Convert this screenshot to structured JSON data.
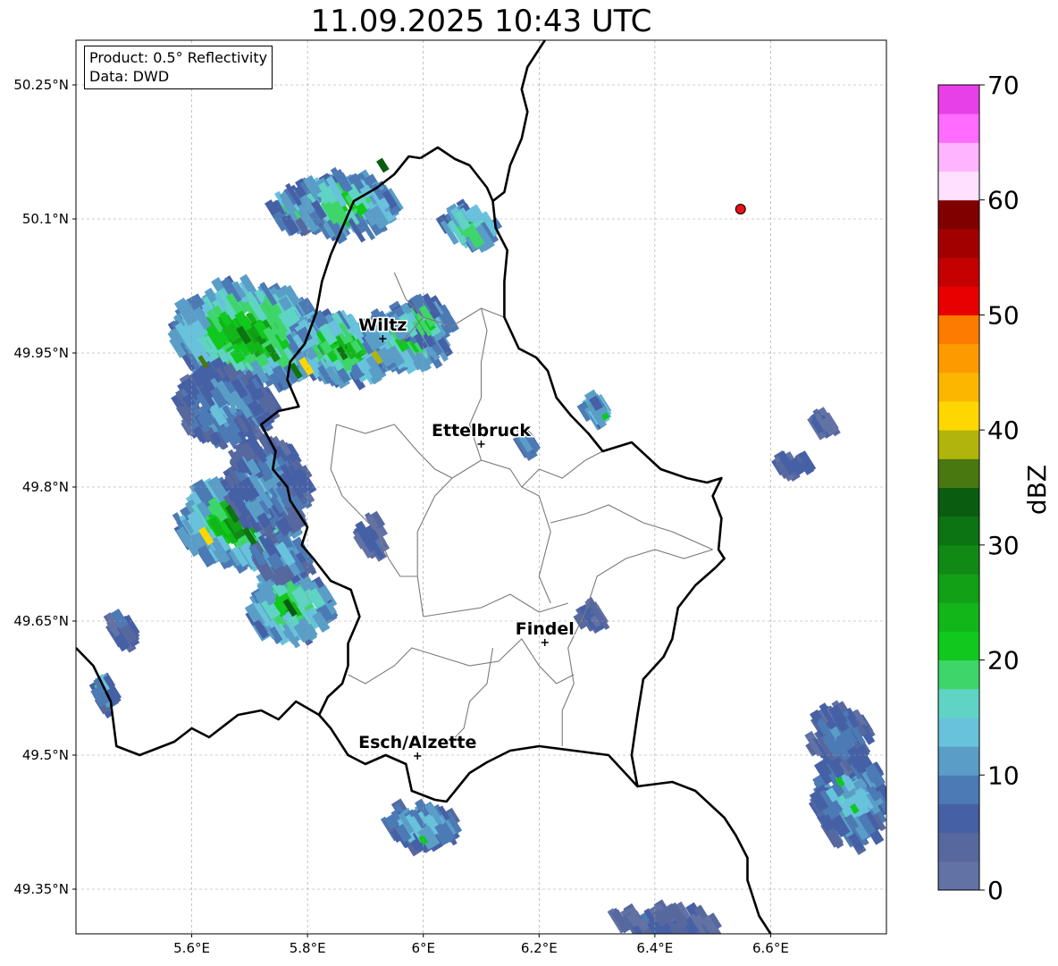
{
  "title": "11.09.2025 10:43 UTC",
  "info": {
    "product": "Product: 0.5° Reflectivity",
    "data": "Data: DWD"
  },
  "map": {
    "lon_range": [
      5.4,
      6.8
    ],
    "lat_range": [
      49.3,
      50.3
    ],
    "lon_ticks": [
      {
        "value": 5.6,
        "label": "5.6°E"
      },
      {
        "value": 5.8,
        "label": "5.8°E"
      },
      {
        "value": 6.0,
        "label": "6°E"
      },
      {
        "value": 6.2,
        "label": "6.2°E"
      },
      {
        "value": 6.4,
        "label": "6.4°E"
      },
      {
        "value": 6.6,
        "label": "6.6°E"
      }
    ],
    "lat_ticks": [
      {
        "value": 49.35,
        "label": "49.35°N"
      },
      {
        "value": 49.5,
        "label": "49.5°N"
      },
      {
        "value": 49.65,
        "label": "49.65°N"
      },
      {
        "value": 49.8,
        "label": "49.8°N"
      },
      {
        "value": 49.95,
        "label": "49.95°N"
      },
      {
        "value": 50.1,
        "label": "50.1°N"
      },
      {
        "value": 50.25,
        "label": "50.25°N"
      }
    ],
    "cities": [
      {
        "name": "Wiltz",
        "lon": 5.93,
        "lat": 49.966
      },
      {
        "name": "Ettelbruck",
        "lon": 6.1,
        "lat": 49.848
      },
      {
        "name": "Findel",
        "lon": 6.21,
        "lat": 49.626
      },
      {
        "name": "Esch/Alzette",
        "lon": 5.99,
        "lat": 49.499
      }
    ],
    "radar_site": {
      "lon": 6.548,
      "lat": 50.111,
      "color": "#e8101a"
    },
    "echo_cells": [
      {
        "lon": 5.7,
        "lat": 49.97,
        "rlon": 0.13,
        "rlat": 0.055,
        "dbz": 26
      },
      {
        "lon": 5.86,
        "lat": 49.955,
        "rlon": 0.09,
        "rlat": 0.035,
        "dbz": 24
      },
      {
        "lon": 5.97,
        "lat": 49.965,
        "rlon": 0.07,
        "rlat": 0.03,
        "dbz": 22
      },
      {
        "lon": 6.0,
        "lat": 49.985,
        "rlon": 0.05,
        "rlat": 0.02,
        "dbz": 20
      },
      {
        "lon": 5.66,
        "lat": 49.89,
        "rlon": 0.08,
        "rlat": 0.04,
        "dbz": 12
      },
      {
        "lon": 5.86,
        "lat": 50.115,
        "rlon": 0.09,
        "rlat": 0.03,
        "dbz": 22
      },
      {
        "lon": 5.78,
        "lat": 50.11,
        "rlon": 0.04,
        "rlat": 0.02,
        "dbz": 18
      },
      {
        "lon": 6.08,
        "lat": 50.09,
        "rlon": 0.045,
        "rlat": 0.02,
        "dbz": 22
      },
      {
        "lon": 5.68,
        "lat": 49.76,
        "rlon": 0.1,
        "rlat": 0.045,
        "dbz": 26
      },
      {
        "lon": 5.73,
        "lat": 49.8,
        "rlon": 0.07,
        "rlat": 0.05,
        "dbz": 12
      },
      {
        "lon": 5.77,
        "lat": 49.665,
        "rlon": 0.07,
        "rlat": 0.035,
        "dbz": 24
      },
      {
        "lon": 5.76,
        "lat": 49.72,
        "rlon": 0.05,
        "rlat": 0.02,
        "dbz": 14
      },
      {
        "lon": 6.0,
        "lat": 49.42,
        "rlon": 0.06,
        "rlat": 0.02,
        "dbz": 16
      },
      {
        "lon": 6.74,
        "lat": 49.45,
        "rlon": 0.06,
        "rlat": 0.05,
        "dbz": 16
      },
      {
        "lon": 6.72,
        "lat": 49.52,
        "rlon": 0.05,
        "rlat": 0.03,
        "dbz": 10
      },
      {
        "lon": 6.42,
        "lat": 49.31,
        "rlon": 0.09,
        "rlat": 0.015,
        "dbz": 6
      },
      {
        "lon": 5.48,
        "lat": 49.64,
        "rlon": 0.02,
        "rlat": 0.015,
        "dbz": 8
      },
      {
        "lon": 5.45,
        "lat": 49.57,
        "rlon": 0.015,
        "rlat": 0.015,
        "dbz": 16
      },
      {
        "lon": 6.3,
        "lat": 49.885,
        "rlon": 0.02,
        "rlat": 0.01,
        "dbz": 20
      },
      {
        "lon": 6.18,
        "lat": 49.85,
        "rlon": 0.01,
        "rlat": 0.008,
        "dbz": 14
      },
      {
        "lon": 6.29,
        "lat": 49.655,
        "rlon": 0.02,
        "rlat": 0.01,
        "dbz": 6
      },
      {
        "lon": 5.91,
        "lat": 49.745,
        "rlon": 0.02,
        "rlat": 0.02,
        "dbz": 8
      },
      {
        "lon": 6.64,
        "lat": 49.825,
        "rlon": 0.03,
        "rlat": 0.006,
        "dbz": 8
      },
      {
        "lon": 6.69,
        "lat": 49.87,
        "rlon": 0.015,
        "rlat": 0.006,
        "dbz": 6
      }
    ],
    "echo_strokes": [
      {
        "lon": 5.69,
        "lat": 49.97,
        "w": 0.012,
        "h": 0.02,
        "dbz": 30
      },
      {
        "lon": 5.74,
        "lat": 49.95,
        "w": 0.012,
        "h": 0.02,
        "dbz": 28
      },
      {
        "lon": 5.78,
        "lat": 49.93,
        "w": 0.01,
        "h": 0.018,
        "dbz": 32
      },
      {
        "lon": 5.86,
        "lat": 49.95,
        "w": 0.01,
        "h": 0.015,
        "dbz": 32
      },
      {
        "lon": 5.67,
        "lat": 49.77,
        "w": 0.01,
        "h": 0.02,
        "dbz": 32
      },
      {
        "lon": 5.7,
        "lat": 49.745,
        "w": 0.01,
        "h": 0.02,
        "dbz": 30
      },
      {
        "lon": 5.625,
        "lat": 49.745,
        "w": 0.012,
        "h": 0.02,
        "dbz": 40
      },
      {
        "lon": 5.798,
        "lat": 49.935,
        "w": 0.012,
        "h": 0.02,
        "dbz": 40
      },
      {
        "lon": 5.92,
        "lat": 49.945,
        "w": 0.01,
        "h": 0.015,
        "dbz": 38
      },
      {
        "lon": 5.77,
        "lat": 49.665,
        "w": 0.01,
        "h": 0.02,
        "dbz": 34
      },
      {
        "lon": 5.93,
        "lat": 50.16,
        "w": 0.012,
        "h": 0.015,
        "dbz": 34
      },
      {
        "lon": 5.62,
        "lat": 49.94,
        "w": 0.008,
        "h": 0.015,
        "dbz": 36
      },
      {
        "lon": 6.0,
        "lat": 49.405,
        "w": 0.01,
        "h": 0.01,
        "dbz": 22
      },
      {
        "lon": 6.745,
        "lat": 49.44,
        "w": 0.01,
        "h": 0.01,
        "dbz": 22
      },
      {
        "lon": 6.72,
        "lat": 49.47,
        "w": 0.01,
        "h": 0.01,
        "dbz": 22
      }
    ],
    "borders": {
      "country_outline": [
        [
          5.995,
          50.168
        ],
        [
          6.025,
          50.18
        ],
        [
          6.055,
          50.167
        ],
        [
          6.08,
          50.16
        ],
        [
          6.11,
          50.135
        ],
        [
          6.12,
          50.12
        ],
        [
          6.125,
          50.09
        ],
        [
          6.145,
          50.065
        ],
        [
          6.14,
          50.03
        ],
        [
          6.14,
          49.99
        ],
        [
          6.165,
          49.955
        ],
        [
          6.195,
          49.945
        ],
        [
          6.215,
          49.93
        ],
        [
          6.23,
          49.9
        ],
        [
          6.255,
          49.88
        ],
        [
          6.285,
          49.86
        ],
        [
          6.31,
          49.84
        ],
        [
          6.36,
          49.85
        ],
        [
          6.41,
          49.82
        ],
        [
          6.455,
          49.81
        ],
        [
          6.49,
          49.805
        ],
        [
          6.515,
          49.81
        ],
        [
          6.5,
          49.79
        ],
        [
          6.515,
          49.765
        ],
        [
          6.51,
          49.73
        ],
        [
          6.52,
          49.72
        ],
        [
          6.505,
          49.71
        ],
        [
          6.47,
          49.69
        ],
        [
          6.44,
          49.665
        ],
        [
          6.43,
          49.63
        ],
        [
          6.415,
          49.61
        ],
        [
          6.38,
          49.585
        ],
        [
          6.37,
          49.545
        ],
        [
          6.36,
          49.5
        ],
        [
          6.37,
          49.465
        ],
        [
          6.32,
          49.5
        ],
        [
          6.26,
          49.505
        ],
        [
          6.2,
          49.51
        ],
        [
          6.15,
          49.505
        ],
        [
          6.11,
          49.492
        ],
        [
          6.08,
          49.48
        ],
        [
          6.04,
          49.448
        ],
        [
          6.02,
          49.45
        ],
        [
          5.98,
          49.46
        ],
        [
          5.97,
          49.49
        ],
        [
          5.935,
          49.5
        ],
        [
          5.9,
          49.49
        ],
        [
          5.87,
          49.5
        ],
        [
          5.84,
          49.53
        ],
        [
          5.82,
          49.545
        ],
        [
          5.835,
          49.565
        ],
        [
          5.86,
          49.58
        ],
        [
          5.87,
          49.6
        ],
        [
          5.87,
          49.625
        ],
        [
          5.89,
          49.655
        ],
        [
          5.875,
          49.685
        ],
        [
          5.84,
          49.695
        ],
        [
          5.81,
          49.72
        ],
        [
          5.79,
          49.735
        ],
        [
          5.8,
          49.755
        ],
        [
          5.77,
          49.785
        ],
        [
          5.765,
          49.8
        ],
        [
          5.74,
          49.82
        ],
        [
          5.745,
          49.84
        ],
        [
          5.72,
          49.87
        ],
        [
          5.75,
          49.885
        ],
        [
          5.785,
          49.89
        ],
        [
          5.765,
          49.92
        ],
        [
          5.77,
          49.94
        ],
        [
          5.795,
          49.96
        ],
        [
          5.815,
          49.995
        ],
        [
          5.825,
          50.03
        ],
        [
          5.84,
          50.06
        ],
        [
          5.86,
          50.09
        ],
        [
          5.88,
          50.12
        ],
        [
          5.92,
          50.135
        ],
        [
          5.95,
          50.15
        ],
        [
          5.975,
          50.17
        ],
        [
          5.995,
          50.168
        ]
      ],
      "belgium_germany": [
        [
          6.12,
          50.12
        ],
        [
          6.14,
          50.13
        ],
        [
          6.15,
          50.16
        ],
        [
          6.17,
          50.19
        ],
        [
          6.18,
          50.22
        ],
        [
          6.17,
          50.245
        ],
        [
          6.18,
          50.27
        ],
        [
          6.2,
          50.29
        ],
        [
          6.21,
          50.3
        ]
      ],
      "france_west": [
        [
          5.4,
          49.62
        ],
        [
          5.43,
          49.6
        ],
        [
          5.46,
          49.56
        ],
        [
          5.47,
          49.51
        ],
        [
          5.51,
          49.5
        ],
        [
          5.57,
          49.515
        ],
        [
          5.6,
          49.53
        ],
        [
          5.63,
          49.52
        ],
        [
          5.68,
          49.545
        ],
        [
          5.72,
          49.55
        ],
        [
          5.75,
          49.54
        ],
        [
          5.78,
          49.56
        ],
        [
          5.82,
          49.545
        ]
      ],
      "germany_south": [
        [
          6.37,
          49.465
        ],
        [
          6.43,
          49.47
        ],
        [
          6.47,
          49.46
        ],
        [
          6.52,
          49.43
        ],
        [
          6.54,
          49.41
        ],
        [
          6.56,
          49.385
        ],
        [
          6.56,
          49.36
        ],
        [
          6.57,
          49.34
        ],
        [
          6.58,
          49.32
        ],
        [
          6.6,
          49.3
        ]
      ],
      "cantons": [
        [
          [
            5.87,
            49.59
          ],
          [
            5.9,
            49.58
          ],
          [
            5.95,
            49.6
          ],
          [
            5.98,
            49.62
          ],
          [
            6.03,
            49.61
          ],
          [
            6.08,
            49.6
          ],
          [
            6.13,
            49.605
          ],
          [
            6.17,
            49.63
          ],
          [
            6.2,
            49.6
          ],
          [
            6.23,
            49.58
          ],
          [
            6.26,
            49.59
          ]
        ],
        [
          [
            6.12,
            49.62
          ],
          [
            6.11,
            49.58
          ],
          [
            6.08,
            49.56
          ],
          [
            6.07,
            49.53
          ],
          [
            6.04,
            49.51
          ]
        ],
        [
          [
            6.24,
            49.51
          ],
          [
            6.24,
            49.55
          ],
          [
            6.26,
            49.58
          ],
          [
            6.25,
            49.62
          ],
          [
            6.28,
            49.66
          ],
          [
            6.3,
            49.7
          ],
          [
            6.35,
            49.72
          ],
          [
            6.4,
            49.73
          ],
          [
            6.45,
            49.72
          ],
          [
            6.5,
            49.73
          ]
        ],
        [
          [
            6.0,
            49.655
          ],
          [
            6.05,
            49.66
          ],
          [
            6.1,
            49.665
          ],
          [
            6.15,
            49.68
          ],
          [
            6.2,
            49.66
          ],
          [
            6.25,
            49.67
          ]
        ],
        [
          [
            6.0,
            49.655
          ],
          [
            5.99,
            49.7
          ],
          [
            5.99,
            49.75
          ],
          [
            6.02,
            49.79
          ],
          [
            6.05,
            49.81
          ],
          [
            6.1,
            49.83
          ],
          [
            6.15,
            49.82
          ],
          [
            6.17,
            49.8
          ],
          [
            6.2,
            49.79
          ],
          [
            6.22,
            49.75
          ],
          [
            6.2,
            49.7
          ],
          [
            6.22,
            49.67
          ]
        ],
        [
          [
            5.85,
            49.87
          ],
          [
            5.9,
            49.86
          ],
          [
            5.95,
            49.87
          ],
          [
            5.99,
            49.84
          ],
          [
            6.02,
            49.82
          ],
          [
            6.05,
            49.81
          ]
        ],
        [
          [
            5.85,
            49.87
          ],
          [
            5.84,
            49.82
          ],
          [
            5.86,
            49.79
          ],
          [
            5.92,
            49.75
          ],
          [
            5.94,
            49.72
          ],
          [
            5.96,
            49.7
          ],
          [
            5.99,
            49.7
          ]
        ],
        [
          [
            6.1,
            49.83
          ],
          [
            6.08,
            49.87
          ],
          [
            6.1,
            49.9
          ],
          [
            6.1,
            49.94
          ],
          [
            6.11,
            49.975
          ],
          [
            6.1,
            50.0
          ]
        ],
        [
          [
            6.17,
            49.8
          ],
          [
            6.2,
            49.82
          ],
          [
            6.24,
            49.81
          ],
          [
            6.28,
            49.83
          ],
          [
            6.31,
            49.84
          ]
        ],
        [
          [
            6.0,
            49.99
          ],
          [
            6.05,
            49.98
          ],
          [
            6.1,
            50.0
          ],
          [
            6.14,
            49.99
          ]
        ],
        [
          [
            5.95,
            50.04
          ],
          [
            5.97,
            50.01
          ],
          [
            6.0,
            49.99
          ],
          [
            5.96,
            49.96
          ]
        ],
        [
          [
            6.22,
            49.76
          ],
          [
            6.28,
            49.77
          ],
          [
            6.32,
            49.78
          ],
          [
            6.38,
            49.76
          ],
          [
            6.43,
            49.75
          ],
          [
            6.5,
            49.73
          ]
        ]
      ]
    }
  },
  "colorbar": {
    "label": "dBZ",
    "min": 0,
    "max": 70,
    "step": 2.5,
    "ticks": [
      {
        "value": 0,
        "label": "0"
      },
      {
        "value": 10,
        "label": "10"
      },
      {
        "value": 20,
        "label": "20"
      },
      {
        "value": 30,
        "label": "30"
      },
      {
        "value": 40,
        "label": "40"
      },
      {
        "value": 50,
        "label": "50"
      },
      {
        "value": 60,
        "label": "60"
      },
      {
        "value": 70,
        "label": "70"
      }
    ],
    "colors": [
      "#6272a4",
      "#56689e",
      "#4660a6",
      "#4c7ab4",
      "#5a9ec8",
      "#68c2dc",
      "#60d4c4",
      "#3ed66a",
      "#10c81e",
      "#12b618",
      "#12a016",
      "#108a14",
      "#0c7410",
      "#0a5c10",
      "#4a7810",
      "#b0b40c",
      "#fed700",
      "#fdb600",
      "#fd9a00",
      "#fd7c00",
      "#e80000",
      "#c40000",
      "#a20000",
      "#800000",
      "#ffe0ff",
      "#ffb4ff",
      "#ff6cff",
      "#e840e8"
    ]
  }
}
